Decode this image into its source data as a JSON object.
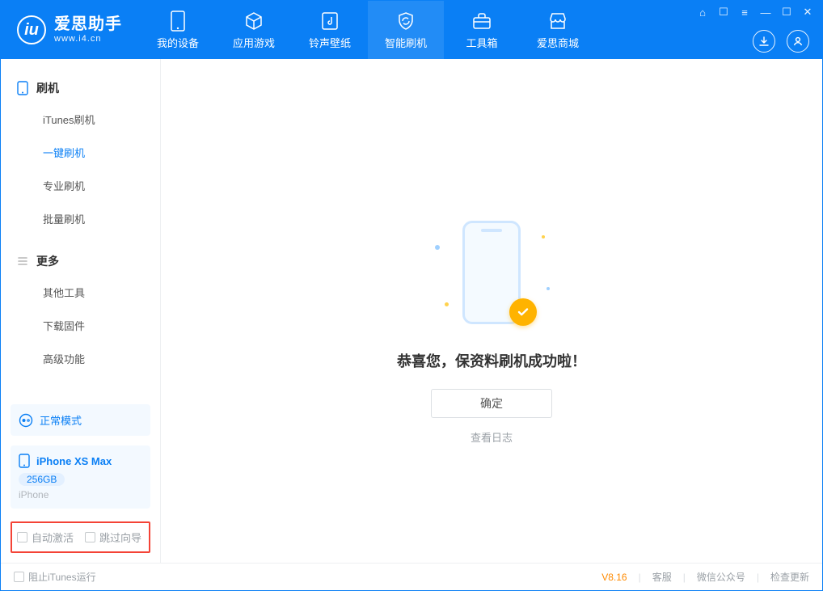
{
  "logo": {
    "name": "爱思助手",
    "url": "www.i4.cn"
  },
  "tabs": {
    "device": "我的设备",
    "apps": "应用游戏",
    "media": "铃声壁纸",
    "flash": "智能刷机",
    "toolbox": "工具箱",
    "store": "爱思商城"
  },
  "sidebar": {
    "group_flash": "刷机",
    "items_flash": {
      "itunes": "iTunes刷机",
      "oneclick": "一键刷机",
      "pro": "专业刷机",
      "batch": "批量刷机"
    },
    "group_more": "更多",
    "items_more": {
      "other": "其他工具",
      "firmware": "下载固件",
      "advanced": "高级功能"
    }
  },
  "mode": {
    "label": "正常模式"
  },
  "device": {
    "name": "iPhone XS Max",
    "capacity": "256GB",
    "sub": "iPhone"
  },
  "options": {
    "auto_activate": "自动激活",
    "skip_guide": "跳过向导"
  },
  "main": {
    "message": "恭喜您，保资料刷机成功啦！",
    "ok": "确定",
    "view_log": "查看日志"
  },
  "footer": {
    "block_itunes": "阻止iTunes运行",
    "version": "V8.16",
    "support": "客服",
    "wechat": "微信公众号",
    "check_update": "检查更新"
  }
}
